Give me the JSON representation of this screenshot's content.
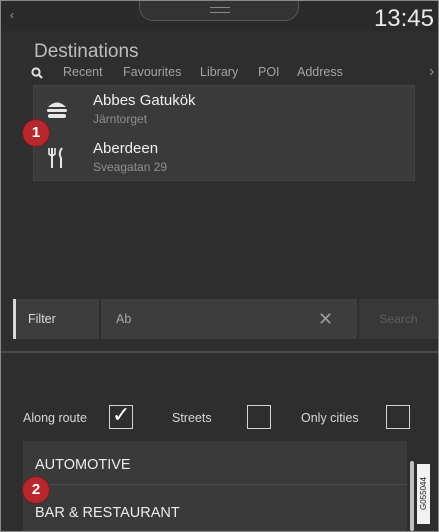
{
  "status": {
    "time": "13:45"
  },
  "header": {
    "title": "Destinations"
  },
  "tabs": [
    {
      "label": "Recent"
    },
    {
      "label": "Favourites"
    },
    {
      "label": "Library"
    },
    {
      "label": "POI"
    },
    {
      "label": "Address"
    }
  ],
  "results": [
    {
      "name": "Abbes Gatukök",
      "sub": "Järntorget",
      "icon": "burger-icon"
    },
    {
      "name": "Aberdeen",
      "sub": "Sveagatan 29",
      "icon": "fork-knife-icon"
    }
  ],
  "callouts": {
    "one": "1",
    "two": "2"
  },
  "filter": {
    "label": "Filter",
    "value": "Ab",
    "search_label": "Search"
  },
  "options": {
    "along_route": {
      "label": "Along route",
      "checked": true
    },
    "streets": {
      "label": "Streets",
      "checked": false
    },
    "only_cities": {
      "label": "Only cities",
      "checked": false
    }
  },
  "categories": [
    {
      "label": "AUTOMOTIVE"
    },
    {
      "label": "BAR & RESTAURANT"
    }
  ],
  "image_code": "G055044",
  "colors": {
    "accent_badge": "#b7282e",
    "panel": "#3a3a3a",
    "background": "#2e2e2e"
  }
}
